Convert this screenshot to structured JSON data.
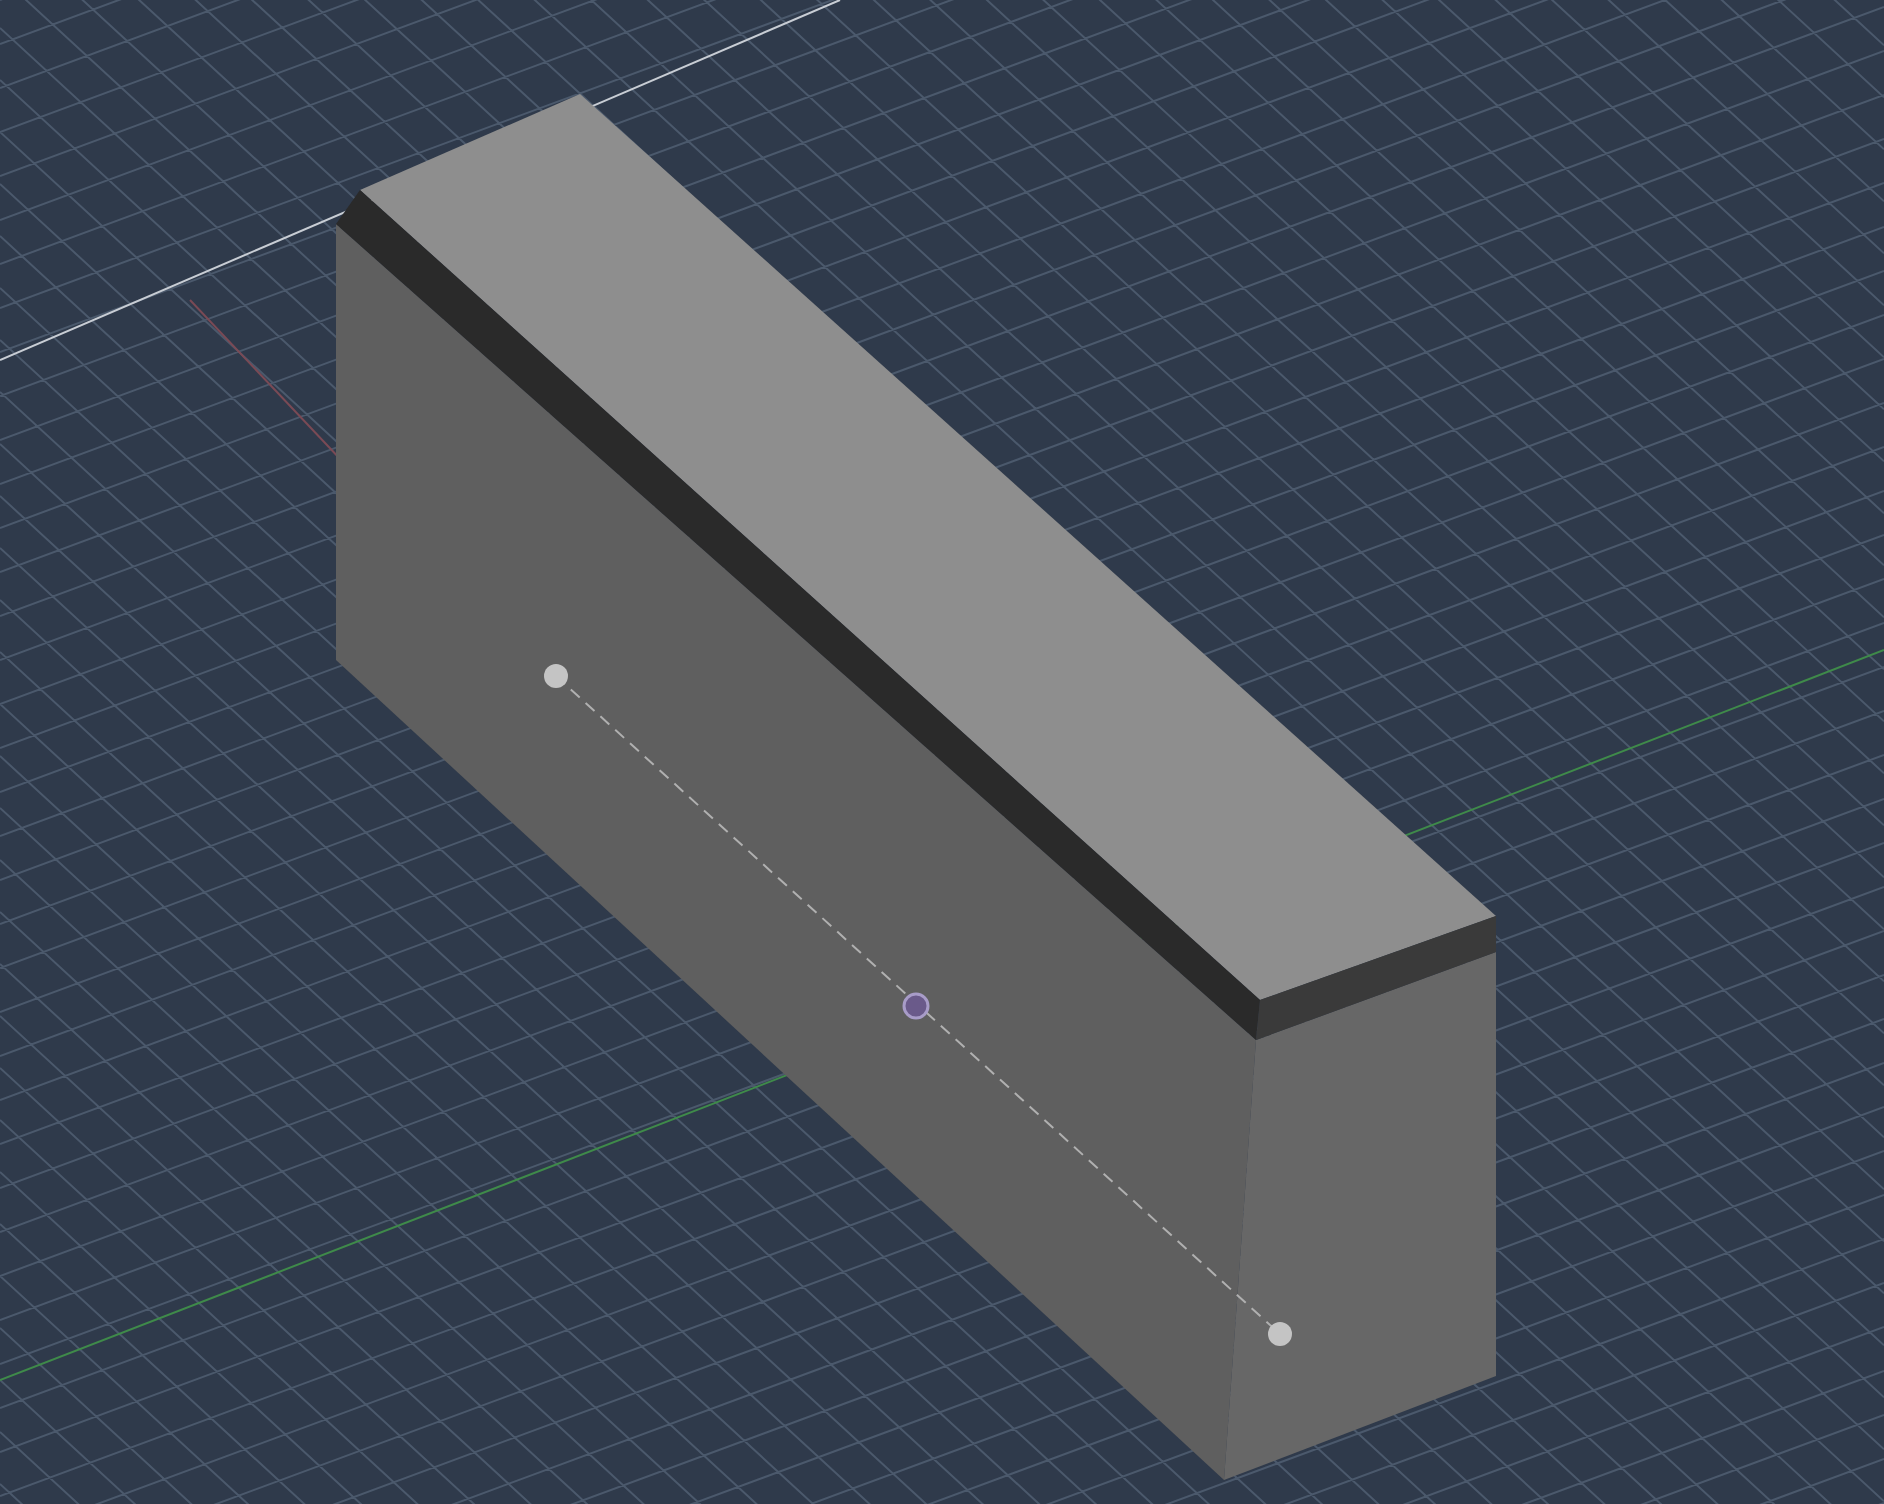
{
  "viewport": {
    "grid": true,
    "selected": true
  }
}
